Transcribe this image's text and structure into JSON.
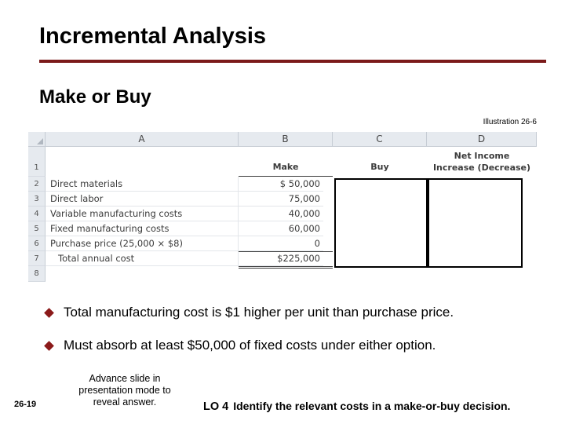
{
  "slide": {
    "title": "Incremental Analysis",
    "subtitle": "Make or Buy",
    "illustration": "Illustration 26-6"
  },
  "spreadsheet": {
    "columns": [
      "A",
      "B",
      "C",
      "D"
    ],
    "row_numbers": [
      "1",
      "2",
      "3",
      "4",
      "5",
      "6",
      "7",
      "8"
    ],
    "headers": {
      "make": "Make",
      "buy": "Buy",
      "net_income": "Net Income",
      "net_income_2": "Increase (Decrease)"
    },
    "rows": [
      {
        "label": "Direct materials",
        "make": "$ 50,000"
      },
      {
        "label": "Direct labor",
        "make": "75,000"
      },
      {
        "label": "Variable manufacturing costs",
        "make": "40,000"
      },
      {
        "label": "Fixed manufacturing costs",
        "make": "60,000"
      },
      {
        "label": "Purchase price (25,000 × $8)",
        "make": "0"
      },
      {
        "label": "Total annual cost",
        "make": "$225,000"
      }
    ]
  },
  "bullets": [
    "Total manufacturing cost is $1 higher per unit than purchase price.",
    "Must absorb at least $50,000 of fixed costs under either option."
  ],
  "footer": {
    "page": "26-19",
    "advance_note": "Advance slide in presentation mode to reveal answer.",
    "lo_code": "LO 4",
    "lo_text": "Identify the relevant costs in a make-or-buy decision."
  },
  "colors": {
    "title_rule": "#7b1a1a",
    "bullet": "#8b1a1a"
  }
}
